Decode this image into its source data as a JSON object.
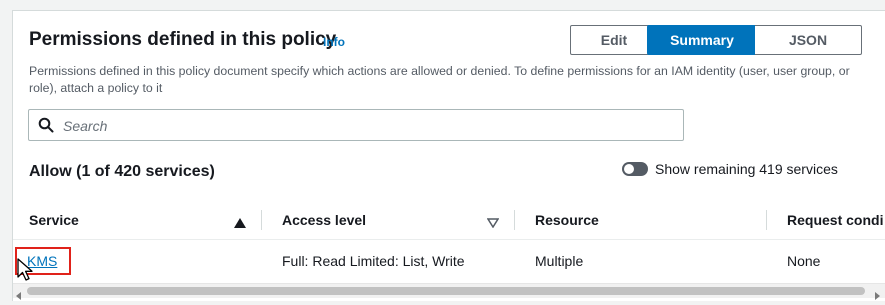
{
  "header": {
    "title": "Permissions defined in this policy",
    "info_link": "Info",
    "tabs": {
      "edit": "Edit",
      "summary": "Summary",
      "json": "JSON",
      "selected": "Summary"
    },
    "description": "Permissions defined in this policy document specify which actions are allowed or denied. To define permissions for an IAM identity (user, user group, or role), attach a policy to it"
  },
  "search": {
    "placeholder": "Search",
    "value": ""
  },
  "allow": {
    "label": "Allow (1 of 420 services)"
  },
  "toggle": {
    "label": "Show remaining 419 services",
    "on": false
  },
  "table": {
    "columns": [
      "Service",
      "Access level",
      "Resource",
      "Request condi"
    ],
    "rows": [
      {
        "service": "KMS",
        "access_level": "Full: Read Limited: List, Write",
        "resource": "Multiple",
        "request_condition": "None"
      }
    ]
  },
  "colors": {
    "accent": "#0073bb",
    "highlight_box": "#e0221a",
    "toggle_off": "#545b64"
  },
  "icons": {
    "search": "search-icon",
    "sort_asc": "sort-ascending-icon",
    "sort_desc": "sort-descending-icon",
    "cursor": "mouse-pointer-icon"
  }
}
